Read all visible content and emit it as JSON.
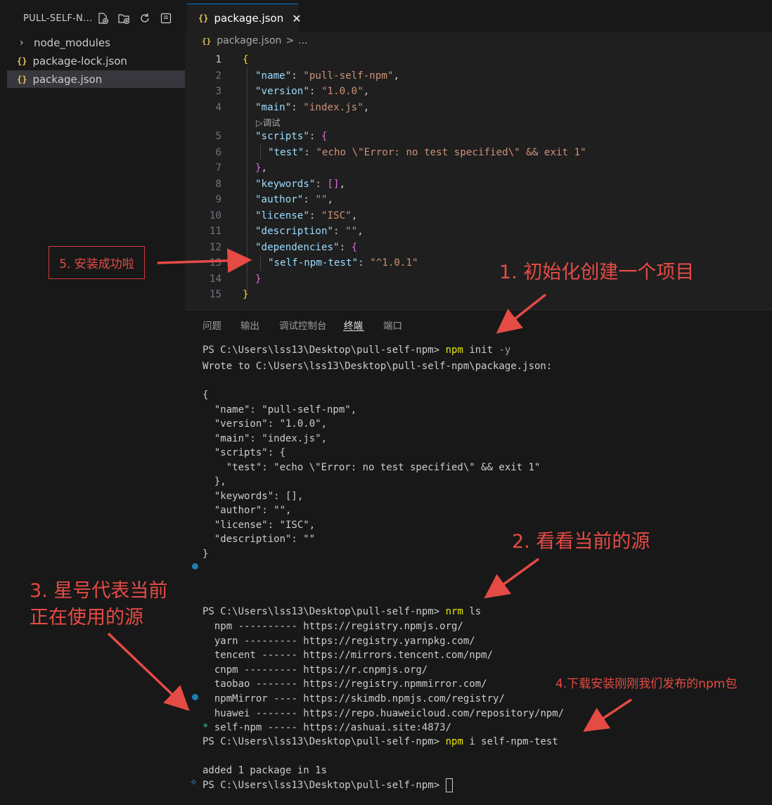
{
  "colors": {
    "annotation": "#e54b45",
    "accent": "#0078d4",
    "json_icon": "#e8c15e"
  },
  "sidebar": {
    "title": "PULL-SELF-N...",
    "action_icons": [
      "new-file-icon",
      "new-folder-icon",
      "refresh-icon",
      "collapse-icon"
    ],
    "items": [
      {
        "label": "node_modules",
        "icon": "chevron-right-icon"
      },
      {
        "label": "package-lock.json",
        "icon": "json-icon"
      },
      {
        "label": "package.json",
        "icon": "json-icon",
        "selected": true
      }
    ]
  },
  "editor": {
    "tab": {
      "label": "package.json",
      "close": "✕",
      "icon": "{}"
    },
    "breadcrumb": {
      "file": "package.json",
      "sep": ">",
      "more": "..."
    },
    "codelens": "▷调试",
    "lines": [
      {
        "n": "1",
        "text": "{"
      },
      {
        "n": "2",
        "text": "\"name\": \"pull-self-npm\","
      },
      {
        "n": "3",
        "text": "\"version\": \"1.0.0\","
      },
      {
        "n": "4",
        "text": "\"main\": \"index.js\","
      },
      {
        "n": "5",
        "text": "\"scripts\": {"
      },
      {
        "n": "6",
        "text": "\"test\": \"echo \\\"Error: no test specified\\\" && exit 1\""
      },
      {
        "n": "7",
        "text": "},"
      },
      {
        "n": "8",
        "text": "\"keywords\": [],"
      },
      {
        "n": "9",
        "text": "\"author\": \"\","
      },
      {
        "n": "10",
        "text": "\"license\": \"ISC\","
      },
      {
        "n": "11",
        "text": "\"description\": \"\","
      },
      {
        "n": "12",
        "text": "\"dependencies\": {"
      },
      {
        "n": "13",
        "text": "\"self-npm-test\": \"^1.0.1\""
      },
      {
        "n": "14",
        "text": "}"
      },
      {
        "n": "15",
        "text": "}"
      }
    ]
  },
  "panel": {
    "tabs": [
      "问题",
      "输出",
      "调试控制台",
      "终端",
      "端口"
    ],
    "active_tab": "终端"
  },
  "terminal": {
    "prompt": "PS C:\\Users\\lss13\\Desktop\\pull-self-npm>",
    "cmd1": {
      "tool": "npm",
      "args": "init",
      "flag": "-y"
    },
    "wrote": "Wrote to C:\\Users\\lss13\\Desktop\\pull-self-npm\\package.json:",
    "json_out": [
      "{",
      "  \"name\": \"pull-self-npm\",",
      "  \"version\": \"1.0.0\",",
      "  \"main\": \"index.js\",",
      "  \"scripts\": {",
      "    \"test\": \"echo \\\"Error: no test specified\\\" && exit 1\"",
      "  },",
      "  \"keywords\": [],",
      "  \"author\": \"\",",
      "  \"license\": \"ISC\",",
      "  \"description\": \"\"",
      "}"
    ],
    "cmd2": {
      "tool": "nrm",
      "args": "ls"
    },
    "registries": [
      {
        "mark": " ",
        "text": " npm ---------- https://registry.npmjs.org/"
      },
      {
        "mark": " ",
        "text": " yarn --------- https://registry.yarnpkg.com/"
      },
      {
        "mark": " ",
        "text": " tencent ------ https://mirrors.tencent.com/npm/"
      },
      {
        "mark": " ",
        "text": " cnpm --------- https://r.cnpmjs.org/"
      },
      {
        "mark": " ",
        "text": " taobao ------- https://registry.npmmirror.com/"
      },
      {
        "mark": " ",
        "text": " npmMirror ---- https://skimdb.npmjs.com/registry/"
      },
      {
        "mark": " ",
        "text": " huawei ------- https://repo.huaweicloud.com/repository/npm/"
      },
      {
        "mark": "*",
        "text": " self-npm ----- https://ashuai.site:4873/"
      }
    ],
    "cmd3": {
      "tool": "npm",
      "args": "i self-npm-test"
    },
    "added": "added 1 package in 1s"
  },
  "annotations": {
    "a1": "1. 初始化创建一个项目",
    "a2": "2. 看看当前的源",
    "a3_line1": "3. 星号代表当前",
    "a3_line2": "正在使用的源",
    "a4": "4.下载安装刚刚我们发布的npm包",
    "a5": "5. 安装成功啦"
  }
}
